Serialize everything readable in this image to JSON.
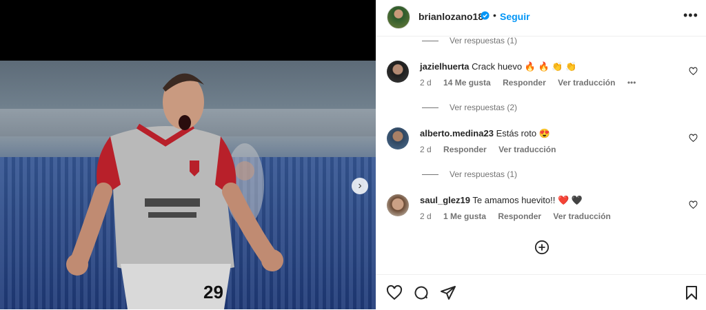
{
  "post": {
    "username": "brianlozano18",
    "follow_label": "Seguir",
    "separator": "•",
    "more_label": "•••"
  },
  "media": {
    "next_label": "›"
  },
  "comments": [
    {
      "replies_before": "Ver respuestas (1)"
    },
    {
      "username": "jazielhuerta",
      "text": "Crack huevo 🔥 🔥 👏 👏",
      "age": "2 d",
      "likes": "14 Me gusta",
      "reply": "Responder",
      "translate": "Ver traducción",
      "options": "•••",
      "replies_after": "Ver respuestas (2)"
    },
    {
      "username": "alberto.medina23",
      "text": "Estás roto 😍",
      "age": "2 d",
      "reply": "Responder",
      "translate": "Ver traducción",
      "replies_after": "Ver respuestas (1)"
    },
    {
      "username": "saul_glez19",
      "text": "Te amamos huevito!! ❤️ 🖤",
      "age": "2 d",
      "likes": "1 Me gusta",
      "reply": "Responder",
      "translate": "Ver traducción"
    }
  ],
  "icons": {
    "verified": "verified-badge-icon",
    "heart": "heart-outline-icon",
    "add": "plus-circle-icon",
    "comment": "comment-icon",
    "share": "paper-plane-icon",
    "save": "bookmark-icon"
  },
  "colors": {
    "accent": "#0095f6",
    "text": "#262626",
    "muted": "#737373"
  }
}
